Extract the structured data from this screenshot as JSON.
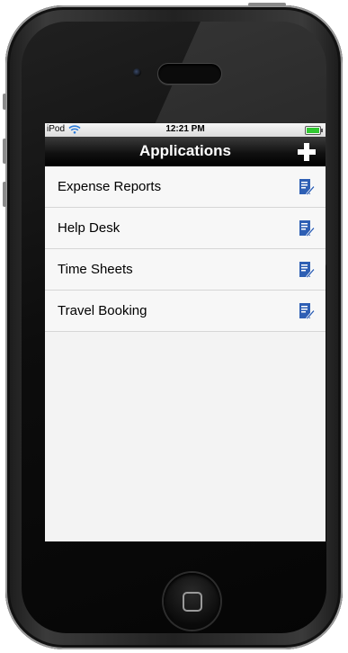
{
  "status_bar": {
    "carrier": "iPod",
    "time": "12:21 PM"
  },
  "nav": {
    "title": "Applications",
    "add_icon": "plus-icon"
  },
  "items": [
    {
      "label": "Expense Reports",
      "icon": "edit-document-icon"
    },
    {
      "label": "Help Desk",
      "icon": "edit-document-icon"
    },
    {
      "label": "Time Sheets",
      "icon": "edit-document-icon"
    },
    {
      "label": "Travel Booking",
      "icon": "edit-document-icon"
    }
  ],
  "colors": {
    "navbar": "#111111",
    "icon_blue": "#2e5fb4",
    "list_bg": "#f3f3f3"
  }
}
